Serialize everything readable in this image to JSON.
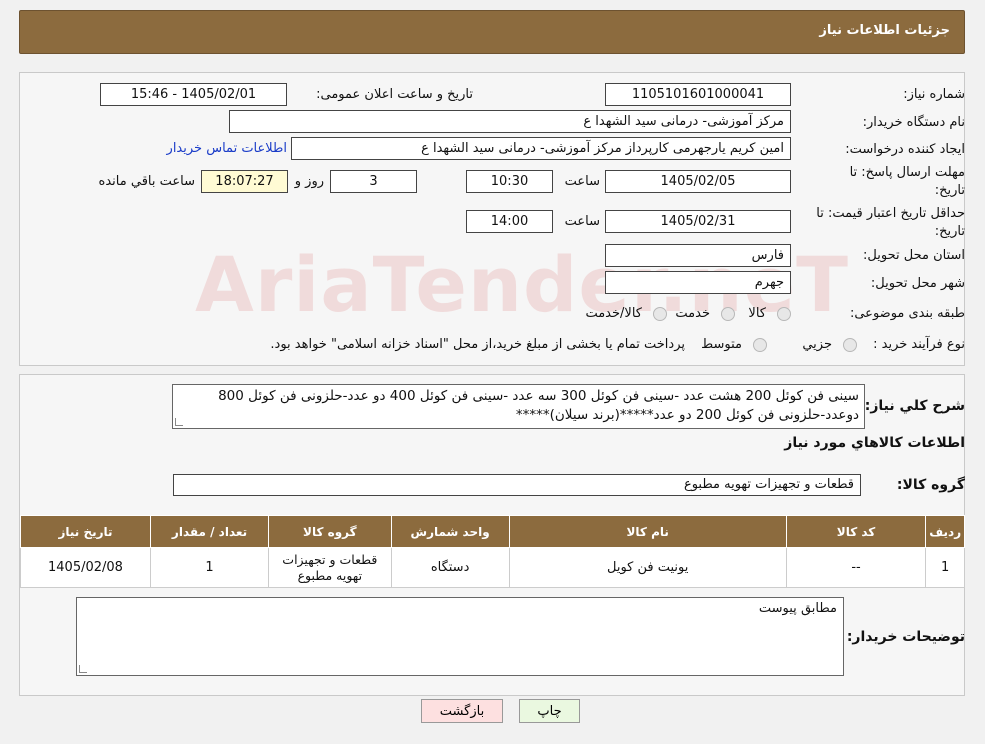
{
  "header": {
    "title": "جزئیات اطلاعات نیاز"
  },
  "fields": {
    "need_number_label": "شماره نیاز:",
    "need_number": "1105101601000041",
    "announce_label": "تاریخ و ساعت اعلان عمومی:",
    "announce_value": "1405/02/01 - 15:46",
    "buyer_org_label": "نام دستگاه خریدار:",
    "buyer_org": "مرکز آموزشی- درمانی سید الشهدا ع",
    "creator_label": "ایجاد کننده درخواست:",
    "creator": "امین کریم یارجهرمی کارپرداز مرکز آموزشی- درمانی سید الشهدا ع",
    "contact_link": "اطلاعات تماس خریدار",
    "deadline_label_1": "مهلت ارسال پاسخ: تا",
    "deadline_label_2": "تاریخ:",
    "deadline_date": "1405/02/05",
    "time_label": "ساعت",
    "deadline_time": "10:30",
    "days_value": "3",
    "days_label": "روز و",
    "remaining_time": "18:07:27",
    "remaining_label": "ساعت باقي مانده",
    "validity_label_1": "حداقل تاریخ اعتبار قیمت: تا",
    "validity_label_2": "تاریخ:",
    "validity_date": "1405/02/31",
    "validity_time": "14:00",
    "province_label": "استان محل تحویل:",
    "province": "فارس",
    "city_label": "شهر محل تحویل:",
    "city": "جهرم",
    "category_label": "طبقه بندی موضوعی:",
    "category_options": [
      "کالا",
      "خدمت",
      "کالا/خدمت"
    ],
    "process_label": "نوع فرآیند خرید :",
    "process_options": [
      "جزيي",
      "متوسط"
    ],
    "process_note": "پرداخت تمام یا بخشی از مبلغ خرید،از محل \"اسناد خزانه اسلامی\" خواهد بود."
  },
  "description": {
    "label": "شرح کلي نياز:",
    "text": "سینی فن کوئل 200 هشت عدد -سینی فن کوئل 300 سه عدد -سینی فن کوئل 400  دو عدد-حلزونی فن کوئل 800 دوعدد-حلزونی فن کوئل 200 دو عدد*****(برند سیلان)*****"
  },
  "goods_section_title": "اطلاعات کالاهاي مورد نياز",
  "goods_group": {
    "label": "گروه کالا:",
    "value": "قطعات و تجهیزات تهویه مطبوع"
  },
  "table": {
    "headers": [
      "رديف",
      "کد کالا",
      "نام کالا",
      "واحد شمارش",
      "گروه کالا",
      "تعداد / مقدار",
      "تاریخ نیاز"
    ],
    "rows": [
      [
        "1",
        "--",
        "یونیت فن کویل",
        "دستگاه",
        "قطعات و تجهیزات تهویه مطبوع",
        "1",
        "1405/02/08"
      ]
    ]
  },
  "buyer_notes": {
    "label": "توضیحات خریدار:",
    "text": "مطابق پیوست"
  },
  "buttons": {
    "print": "چاپ",
    "back": "بازگشت"
  },
  "watermark_text": "AriaTender.neT",
  "colors": {
    "header_bg": "#8c6b3e",
    "print_btn": "#eaf8e0",
    "back_btn": "#fde0e0",
    "highlight": "#fffbd4"
  }
}
